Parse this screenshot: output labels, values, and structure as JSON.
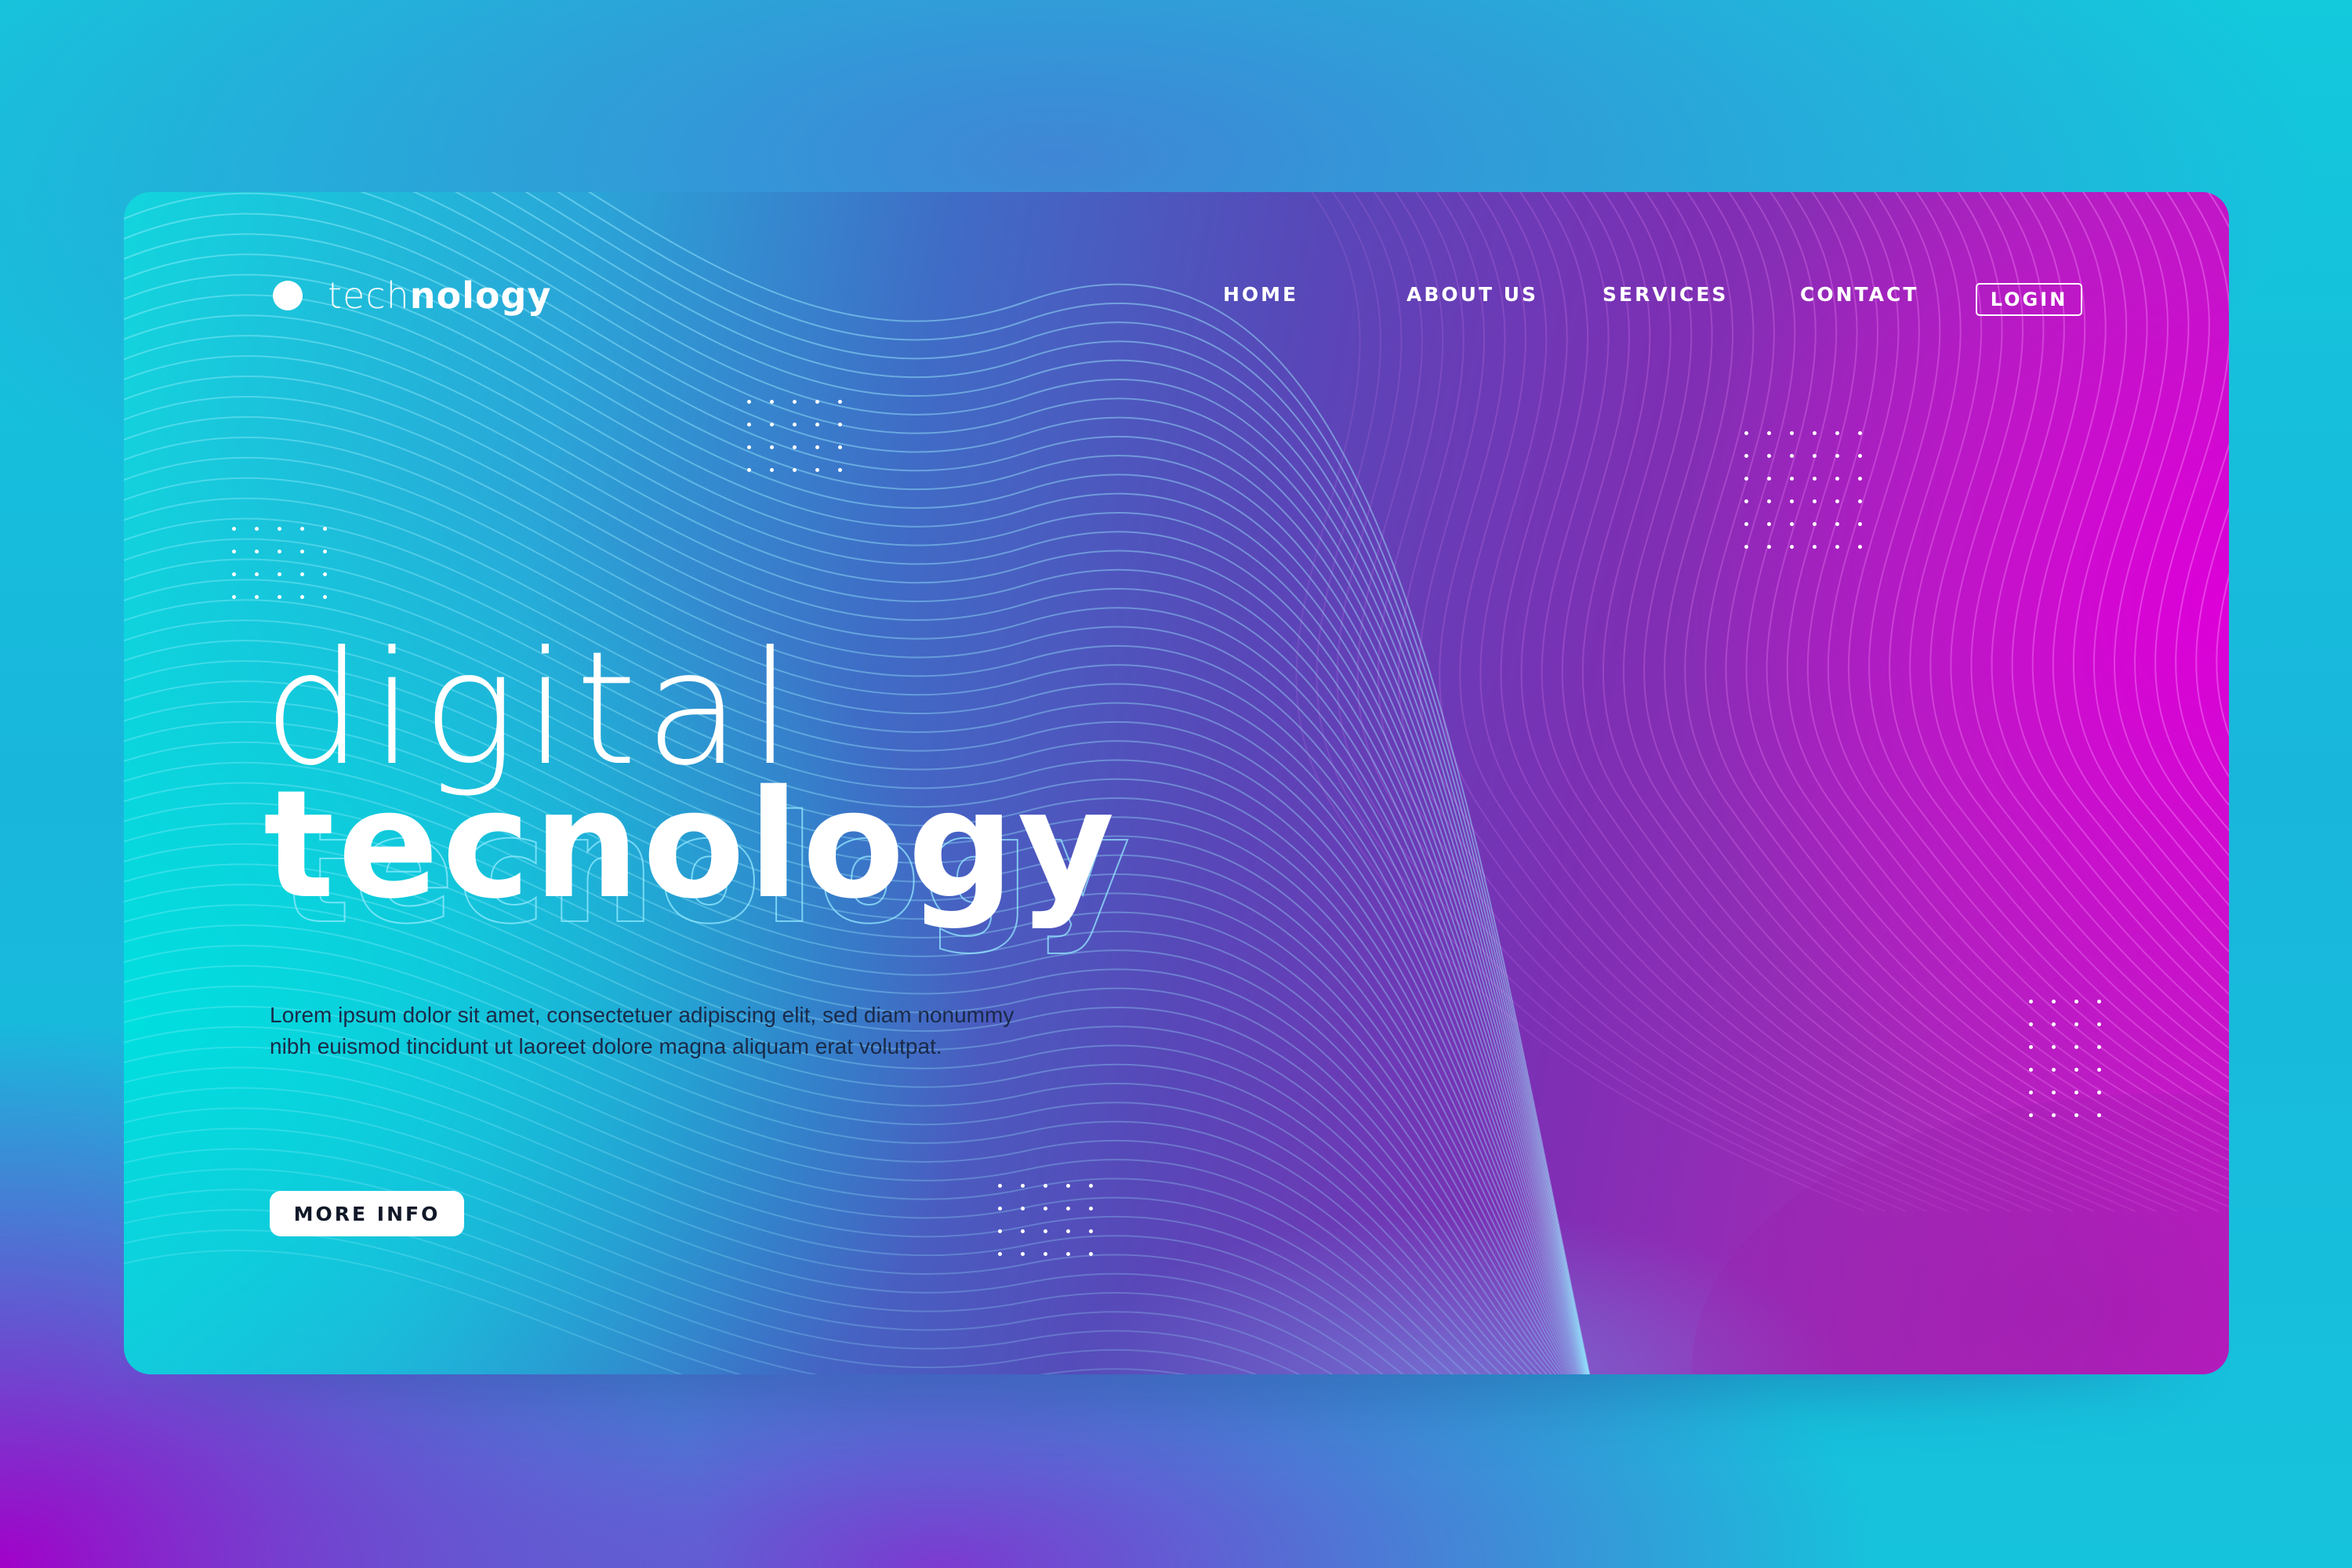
{
  "brand": {
    "logo_light": "tech",
    "logo_bold": "nology",
    "logo_icon": "circle-dot-icon"
  },
  "nav": {
    "items": [
      {
        "label": "HOME"
      },
      {
        "label": "ABOUT US"
      },
      {
        "label": "SERVICES"
      },
      {
        "label": "CONTACT"
      }
    ],
    "login_label": "LOGIN"
  },
  "hero": {
    "title_light": "digital",
    "title_bold": "tecnology",
    "description": "Lorem ipsum dolor sit amet, consectetuer adipiscing elit, sed diam nonummy nibh euismod tincidunt ut laoreet dolore magna aliquam erat volutpat.",
    "cta_label": "MORE INFO"
  },
  "colors": {
    "cyan": "#12d5dd",
    "blue": "#3f6cc6",
    "purple": "#7d2fb4",
    "magenta": "#dc00d8",
    "text_dark": "#1a2a48",
    "white": "#ffffff"
  }
}
